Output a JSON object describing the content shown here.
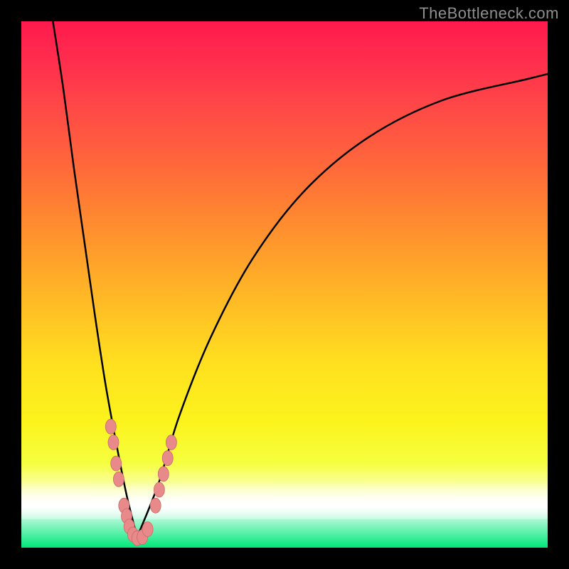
{
  "watermark": "TheBottleneck.com",
  "colors": {
    "gradient_top": "#ff1a4d",
    "gradient_mid": "#ffe01f",
    "gradient_bottom": "#00e87a",
    "frame": "#000000",
    "curve": "#000000",
    "marker_fill": "#e88a8a",
    "marker_stroke": "#c96a6a"
  },
  "chart_data": {
    "type": "line",
    "title": "",
    "xlabel": "",
    "ylabel": "",
    "xlim": [
      0,
      100
    ],
    "ylim": [
      0,
      100
    ],
    "grid": false,
    "legend_position": "none",
    "note": "Two smooth curves forming a V shape with minimum near x≈22; values read from vertical position in the gradient image (0=bottom, 100=top). Background color encodes the same y-value (red high → green low).",
    "series": [
      {
        "name": "left-branch",
        "x": [
          6,
          8,
          10,
          12,
          14,
          16,
          18,
          20,
          22
        ],
        "values": [
          100,
          87,
          72,
          58,
          44,
          31,
          20,
          10,
          2
        ]
      },
      {
        "name": "right-branch",
        "x": [
          22,
          26,
          30,
          36,
          44,
          54,
          66,
          80,
          96,
          100
        ],
        "values": [
          2,
          12,
          25,
          40,
          55,
          68,
          78,
          85,
          89,
          90
        ]
      }
    ],
    "markers": {
      "note": "Highlighted sample points near the valley, drawn as salmon dots/lozenges",
      "points": [
        {
          "x": 17.0,
          "y": 23
        },
        {
          "x": 17.5,
          "y": 20
        },
        {
          "x": 18.0,
          "y": 16
        },
        {
          "x": 18.5,
          "y": 13
        },
        {
          "x": 19.5,
          "y": 8
        },
        {
          "x": 20.0,
          "y": 6
        },
        {
          "x": 20.5,
          "y": 4
        },
        {
          "x": 21.2,
          "y": 2.5
        },
        {
          "x": 22.0,
          "y": 1.8
        },
        {
          "x": 23.0,
          "y": 2
        },
        {
          "x": 24.0,
          "y": 3.5
        },
        {
          "x": 25.5,
          "y": 8
        },
        {
          "x": 26.2,
          "y": 11
        },
        {
          "x": 27.0,
          "y": 14
        },
        {
          "x": 27.8,
          "y": 17
        },
        {
          "x": 28.5,
          "y": 20
        }
      ]
    }
  }
}
